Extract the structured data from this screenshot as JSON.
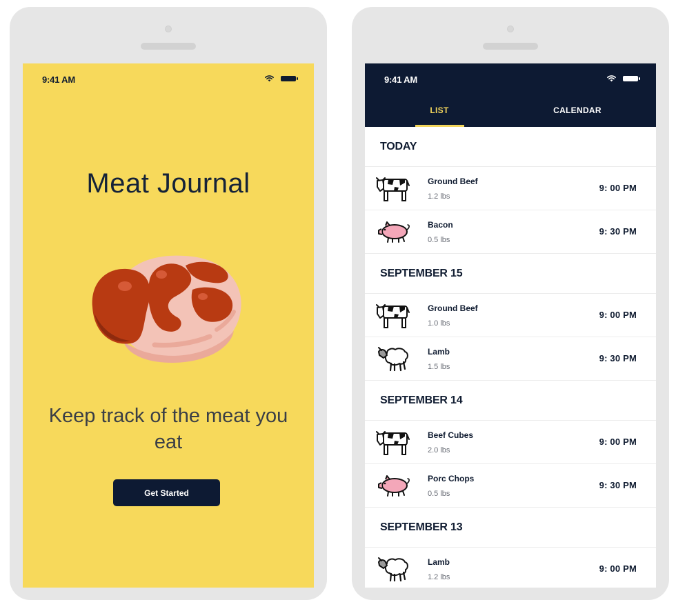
{
  "welcome_screen": {
    "status_time": "9:41 AM",
    "title": "Meat Journal",
    "tagline": "Keep track of the meat you eat",
    "cta_label": "Get Started"
  },
  "list_screen": {
    "status_time": "9:41 AM",
    "tabs": [
      {
        "label": "LIST",
        "active": true
      },
      {
        "label": "CALENDAR",
        "active": false
      }
    ],
    "sections": [
      {
        "heading": "TODAY",
        "entries": [
          {
            "animal_icon": "cow-icon",
            "name": "Ground Beef",
            "weight": "1.2 lbs",
            "time": "9: 00 PM"
          },
          {
            "animal_icon": "pig-icon",
            "name": "Bacon",
            "weight": "0.5 lbs",
            "time": "9: 30 PM"
          }
        ]
      },
      {
        "heading": "SEPTEMBER 15",
        "entries": [
          {
            "animal_icon": "cow-icon",
            "name": "Ground Beef",
            "weight": "1.0 lbs",
            "time": "9: 00 PM"
          },
          {
            "animal_icon": "sheep-icon",
            "name": "Lamb",
            "weight": "1.5 lbs",
            "time": "9: 30 PM"
          }
        ]
      },
      {
        "heading": "SEPTEMBER 14",
        "entries": [
          {
            "animal_icon": "cow-icon",
            "name": "Beef Cubes",
            "weight": "2.0 lbs",
            "time": "9: 00 PM"
          },
          {
            "animal_icon": "pig-icon",
            "name": "Porc Chops",
            "weight": "0.5 lbs",
            "time": "9: 30 PM"
          }
        ]
      },
      {
        "heading": "SEPTEMBER 13",
        "entries": [
          {
            "animal_icon": "sheep-icon",
            "name": "Lamb",
            "weight": "1.2 lbs",
            "time": "9: 00 PM"
          }
        ]
      }
    ]
  },
  "colors": {
    "welcome_background": "#f7d95b",
    "navy": "#0d1a33",
    "accent_yellow": "#f2d55c",
    "device_frame": "#e6e6e6"
  }
}
